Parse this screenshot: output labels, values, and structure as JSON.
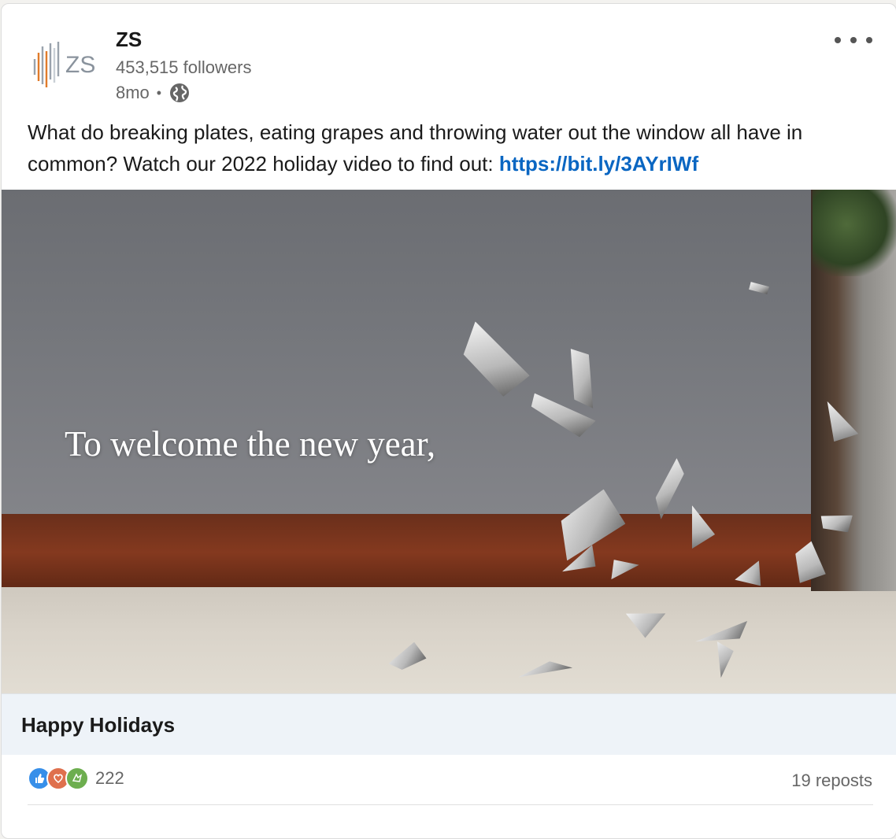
{
  "post": {
    "company_name": "ZS",
    "followers": "453,515 followers",
    "time_ago": "8mo",
    "separator": "•",
    "logo_text": "ZS",
    "body_text": "What do breaking plates, eating grapes and throwing water out the window all have in common? Watch our 2022 holiday video to find out: ",
    "link_text": "https://bit.ly/3AYrIWf"
  },
  "video": {
    "caption": "To welcome the new year,",
    "title": "Happy Holidays"
  },
  "social": {
    "reaction_count": "222",
    "reposts": "19 reposts"
  },
  "colors": {
    "link": "#0a66c2",
    "like": "#378fe9",
    "love": "#df704d",
    "support": "#6dae4f"
  }
}
